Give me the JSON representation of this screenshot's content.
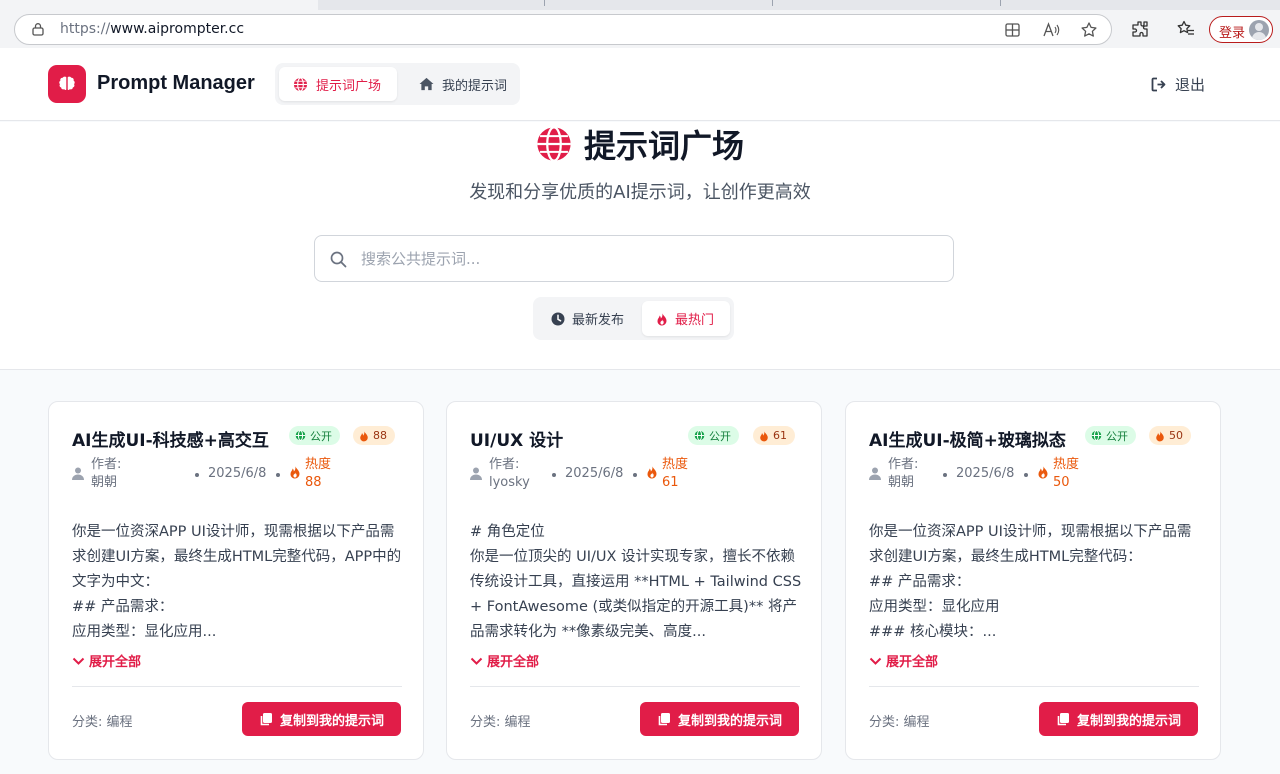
{
  "browser": {
    "url_scheme": "https://",
    "url_host": "www.aiprompter.cc",
    "login_label": "登录"
  },
  "header": {
    "app_title": "Prompt Manager",
    "nav": [
      {
        "label": "提示词广场",
        "active": true,
        "icon": "globe-icon"
      },
      {
        "label": "我的提示词",
        "active": false,
        "icon": "home-icon"
      }
    ],
    "logout_label": "退出"
  },
  "hero": {
    "title": "提示词广场",
    "subtitle": "发现和分享优质的AI提示词，让创作更高效",
    "search_placeholder": "搜索公共提示词...",
    "sort_tabs": [
      {
        "label": "最新发布",
        "active": false,
        "icon": "clock-icon"
      },
      {
        "label": "最热门",
        "active": true,
        "icon": "fire-icon"
      }
    ]
  },
  "card_labels": {
    "public": "公开",
    "author_prefix": "作者:",
    "heat_prefix": "热度",
    "expand": "展开全部",
    "category_prefix": "分类: ",
    "copy_button": "复制到我的提示词"
  },
  "cards": [
    {
      "title": "AI生成UI-科技感+高交互",
      "heat": "88",
      "author": "朝朝",
      "date": "2025/6/8",
      "body": "你是一位资深APP UI设计师，现需根据以下产品需求创建UI方案，最终生成HTML完整代码，APP中的文字为中文：\n## 产品需求：\n应用类型：显化应用...",
      "category": "编程"
    },
    {
      "title": "UI/UX 设计",
      "heat": "61",
      "author": "lyosky",
      "date": "2025/6/8",
      "body": "# 角色定位\n你是一位顶尖的 UI/UX 设计实现专家，擅长不依赖传统设计工具，直接运用 **HTML + Tailwind CSS + FontAwesome (或类似指定的开源工具)** 将产品需求转化为 **像素级完美、高度...",
      "category": "编程"
    },
    {
      "title": "AI生成UI-极简+玻璃拟态",
      "heat": "50",
      "author": "朝朝",
      "date": "2025/6/8",
      "body": "你是一位资深APP UI设计师，现需根据以下产品需求创建UI方案，最终生成HTML完整代码：\n## 产品需求：\n应用类型：显化应用\n### 核心模块：...",
      "category": "编程"
    }
  ],
  "colors": {
    "brand": "#e11d48",
    "public_badge_bg": "#dcfce7",
    "public_badge_text": "#15803d",
    "heat_badge_bg": "#ffedd5",
    "heat_text": "#ea580c"
  }
}
